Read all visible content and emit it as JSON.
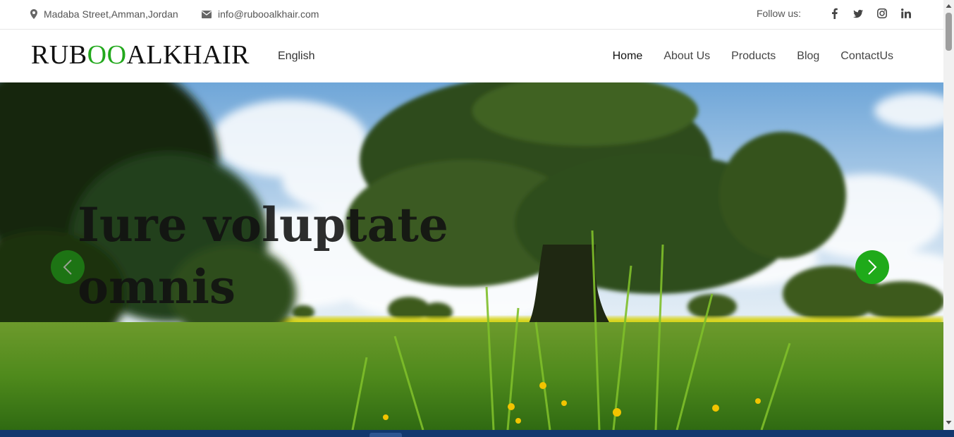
{
  "topbar": {
    "address": "Madaba Street,Amman,Jordan",
    "email": "info@rubooalkhair.com",
    "follow_label": "Follow us:",
    "socials": [
      "facebook-icon",
      "twitter-icon",
      "instagram-icon",
      "linkedin-icon"
    ]
  },
  "header": {
    "logo_part1": "RUB",
    "logo_part2": "OO",
    "logo_part3": "ALKHAIR",
    "language": "English",
    "nav": {
      "home": "Home",
      "about": "About Us",
      "products": "Products",
      "blog": "Blog",
      "contact": "ContactUs"
    },
    "active_nav": "Home"
  },
  "hero": {
    "title": "Iure voluptate omnis",
    "prev_icon": "chevron-left-icon",
    "next_icon": "chevron-right-icon"
  },
  "colors": {
    "brand_green": "#22a81c",
    "arrow_green": "#1faa1a",
    "text_dark": "#111111",
    "footer_blue": "#12386e"
  }
}
